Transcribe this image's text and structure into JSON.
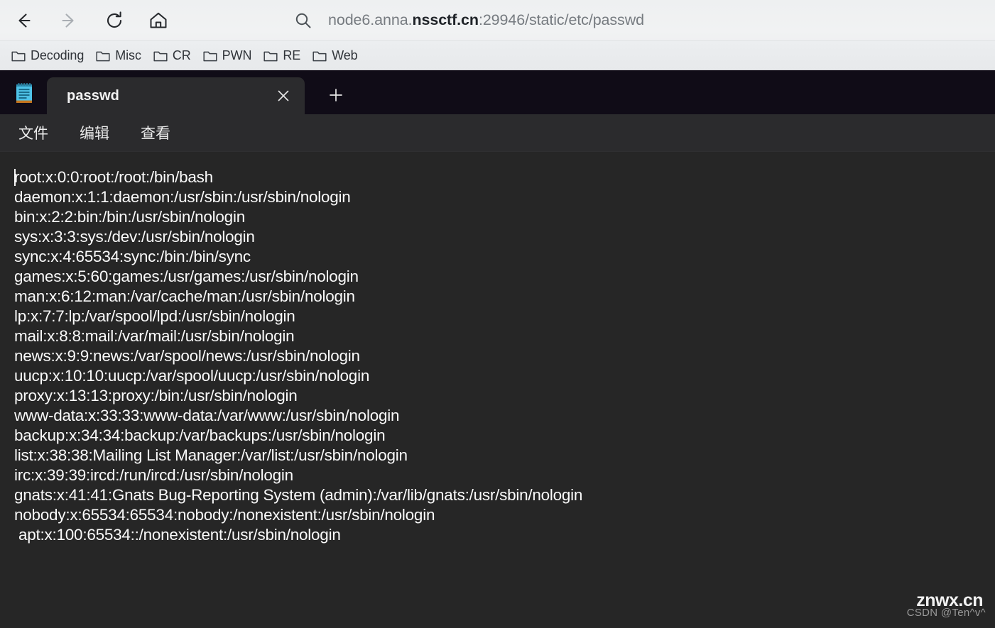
{
  "browser": {
    "nav": {
      "back_label": "Back",
      "forward_label": "Forward",
      "reload_label": "Reload",
      "home_label": "Home"
    },
    "address_bar": {
      "search_icon": "search-icon",
      "url_prefix": "node6.anna.",
      "url_host_strong": "nssctf.cn",
      "url_suffix": ":29946/static/etc/passwd",
      "url_full": "node6.anna.nssctf.cn:29946/static/etc/passwd"
    },
    "bookmarks": [
      {
        "label": "Decoding",
        "icon": "folder-icon"
      },
      {
        "label": "Misc",
        "icon": "folder-icon"
      },
      {
        "label": "CR",
        "icon": "folder-icon"
      },
      {
        "label": "PWN",
        "icon": "folder-icon"
      },
      {
        "label": "RE",
        "icon": "folder-icon"
      },
      {
        "label": "Web",
        "icon": "folder-icon"
      }
    ]
  },
  "notepad": {
    "app_icon": "notepad-icon",
    "tab": {
      "title": "passwd",
      "close_icon": "close-icon"
    },
    "new_tab_icon": "plus-icon",
    "menu": [
      {
        "label": "文件"
      },
      {
        "label": "编辑"
      },
      {
        "label": "查看"
      }
    ],
    "document_lines": [
      "root:x:0:0:root:/root:/bin/bash",
      "daemon:x:1:1:daemon:/usr/sbin:/usr/sbin/nologin",
      "bin:x:2:2:bin:/bin:/usr/sbin/nologin",
      "sys:x:3:3:sys:/dev:/usr/sbin/nologin",
      "sync:x:4:65534:sync:/bin:/bin/sync",
      "games:x:5:60:games:/usr/games:/usr/sbin/nologin",
      "man:x:6:12:man:/var/cache/man:/usr/sbin/nologin",
      "lp:x:7:7:lp:/var/spool/lpd:/usr/sbin/nologin",
      "mail:x:8:8:mail:/var/mail:/usr/sbin/nologin",
      "news:x:9:9:news:/var/spool/news:/usr/sbin/nologin",
      "uucp:x:10:10:uucp:/var/spool/uucp:/usr/sbin/nologin",
      "proxy:x:13:13:proxy:/bin:/usr/sbin/nologin",
      "www-data:x:33:33:www-data:/var/www:/usr/sbin/nologin",
      "backup:x:34:34:backup:/var/backups:/usr/sbin/nologin",
      "list:x:38:38:Mailing List Manager:/var/list:/usr/sbin/nologin",
      "irc:x:39:39:ircd:/run/ircd:/usr/sbin/nologin",
      "gnats:x:41:41:Gnats Bug-Reporting System (admin):/var/lib/gnats:/usr/sbin/nologin",
      "nobody:x:65534:65534:nobody:/nonexistent:/usr/sbin/nologin",
      " apt:x:100:65534::/nonexistent:/usr/sbin/nologin"
    ]
  },
  "watermark": {
    "main": "znwx.cn",
    "sub": "CSDN @Ten^v^"
  },
  "colors": {
    "chrome_bg": "#f1f2f3",
    "titlebar_bg": "#100c17",
    "tab_bg": "#2b2b2d",
    "editor_bg": "#262626",
    "text": "#fafafa",
    "url_muted": "#767b80",
    "url_strong": "#1f2328"
  }
}
